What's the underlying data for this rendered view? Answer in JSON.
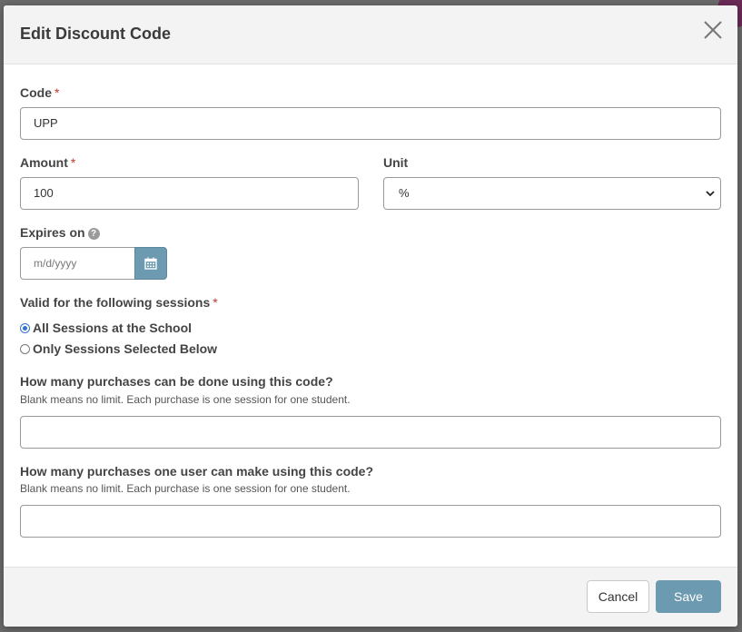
{
  "modal": {
    "title": "Edit Discount Code"
  },
  "form": {
    "code": {
      "label": "Code",
      "required_mark": "*",
      "value": "UPP"
    },
    "amount": {
      "label": "Amount",
      "required_mark": "*",
      "value": "100"
    },
    "unit": {
      "label": "Unit",
      "selected": "%"
    },
    "expires": {
      "label": "Expires on",
      "placeholder": "m/d/yyyy"
    },
    "sessions": {
      "label": "Valid for the following sessions",
      "required_mark": "*",
      "options": [
        {
          "label": "All Sessions at the School",
          "checked": true
        },
        {
          "label": "Only Sessions Selected Below",
          "checked": false
        }
      ]
    },
    "purchases_total": {
      "label": "How many purchases can be done using this code?",
      "hint": "Blank means no limit. Each purchase is one session for one student.",
      "value": ""
    },
    "purchases_per_user": {
      "label": "How many purchases one user can make using this code?",
      "hint": "Blank means no limit. Each purchase is one session for one student.",
      "value": ""
    }
  },
  "footer": {
    "cancel_label": "Cancel",
    "save_label": "Save"
  },
  "colors": {
    "primary_button": "#6c9bb1",
    "required": "#c0392b",
    "radio_selected": "#2f74d0"
  },
  "icons": {
    "close": "close-icon",
    "calendar": "calendar-icon",
    "help": "help-circle-icon",
    "select_caret": "chevron-down-icon"
  }
}
